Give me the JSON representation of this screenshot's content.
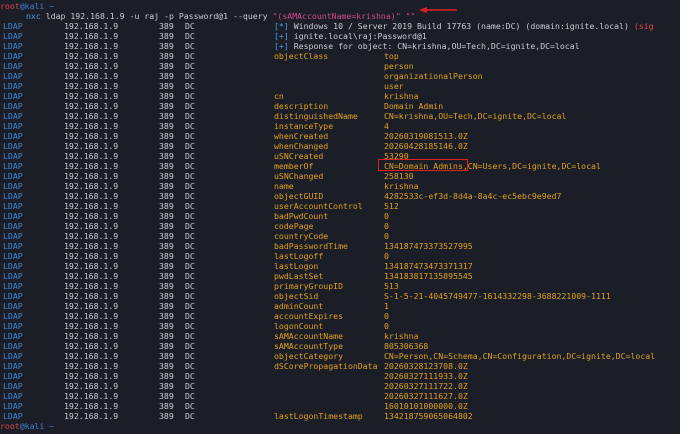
{
  "prompt_top": "root@kali ~",
  "prompt_bottom": "root@kali ~",
  "command": {
    "program": "nxc",
    "args": " ldap 192.168.1.9 -u raj -p Password@1 --query ",
    "query": "\"(sAMAccountName=krishna)\" \"\""
  },
  "row_prefix": {
    "protocol": "LDAP",
    "ip": "192.168.1.9",
    "port": "389",
    "host": "DC"
  },
  "info_lines": [
    {
      "bullet": "[*]",
      "text": " Windows 10 / Server 2019 Build 17763 (name:DC) (domain:ignite.local) (sig"
    },
    {
      "bullet": "[+]",
      "text": " ignite.local\\raj:Password@1"
    },
    {
      "bullet": "[+]",
      "text": " Response for object: CN=krishna,OU=Tech,DC=ignite,DC=local"
    }
  ],
  "attributes": [
    {
      "name": "objectClass",
      "value": "top"
    },
    {
      "name": "",
      "value": "person"
    },
    {
      "name": "",
      "value": "organizationalPerson"
    },
    {
      "name": "",
      "value": "user"
    },
    {
      "name": "cn",
      "value": "krishna"
    },
    {
      "name": "description",
      "value": "Domain Admin"
    },
    {
      "name": "distinguishedName",
      "value": "CN=krishna,OU=Tech,DC=ignite,DC=local"
    },
    {
      "name": "instanceType",
      "value": "4"
    },
    {
      "name": "whenCreated",
      "value": "20260319081513.0Z"
    },
    {
      "name": "whenChanged",
      "value": "20260428185146.0Z"
    },
    {
      "name": "uSNCreated",
      "value": "53290"
    },
    {
      "name": "memberOf",
      "value": "CN=Domain Admins,CN=Users,DC=ignite,DC=local"
    },
    {
      "name": "uSNChanged",
      "value": "258130"
    },
    {
      "name": "name",
      "value": "krishna"
    },
    {
      "name": "objectGUID",
      "value": "4282533c-ef3d-8d4a-8a4c-ec5ebc9e9ed7"
    },
    {
      "name": "userAccountControl",
      "value": "512"
    },
    {
      "name": "badPwdCount",
      "value": "0"
    },
    {
      "name": "codePage",
      "value": "0"
    },
    {
      "name": "countryCode",
      "value": "0"
    },
    {
      "name": "badPasswordTime",
      "value": "134187473373527995"
    },
    {
      "name": "lastLogoff",
      "value": "0"
    },
    {
      "name": "lastLogon",
      "value": "134187473473371317"
    },
    {
      "name": "pwdLastSet",
      "value": "134183817135895545"
    },
    {
      "name": "primaryGroupID",
      "value": "513"
    },
    {
      "name": "objectSid",
      "value": "S-1-5-21-4045749477-1614332298-3688221009-1111"
    },
    {
      "name": "adminCount",
      "value": "1"
    },
    {
      "name": "accountExpires",
      "value": "0"
    },
    {
      "name": "logonCount",
      "value": "0"
    },
    {
      "name": "sAMAccountName",
      "value": "krishna"
    },
    {
      "name": "sAMAccountType",
      "value": "805306368"
    },
    {
      "name": "objectCategory",
      "value": "CN=Person,CN=Schema,CN=Configuration,DC=ignite,DC=local"
    },
    {
      "name": "dSCorePropagationData",
      "value": "20260328123708.0Z"
    },
    {
      "name": "",
      "value": "20260327111933.0Z"
    },
    {
      "name": "",
      "value": "20260327111722.0Z"
    },
    {
      "name": "",
      "value": "20260327111627.0Z"
    },
    {
      "name": "",
      "value": "16010101000000.0Z"
    },
    {
      "name": "lastLogonTimestamp",
      "value": "134218759065064802"
    }
  ],
  "colors": {
    "background": "#1b1e27",
    "prompt": "#3f7fd6",
    "attribute": "#e0a020",
    "protocol": "#3f86d8",
    "highlight": "#e02020"
  }
}
